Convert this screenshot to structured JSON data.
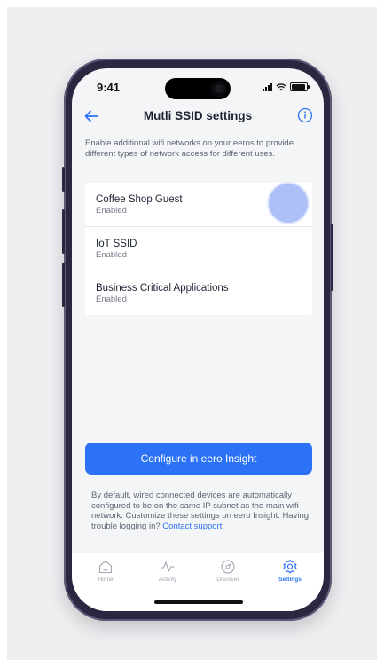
{
  "status_bar": {
    "time": "9:41"
  },
  "header": {
    "title": "Mutli SSID settings"
  },
  "intro_text": "Enable additional wifi networks on your eeros to provide different types of network access for different uses.",
  "networks": [
    {
      "name": "Coffee Shop Guest",
      "status": "Enabled"
    },
    {
      "name": "IoT SSID",
      "status": "Enabled"
    },
    {
      "name": "Business Critical Applications",
      "status": "Enabled"
    }
  ],
  "configure_button": {
    "label": "Configure in eero Insight"
  },
  "footnote": {
    "text": "By default, wired connected devices are automatically configured to be on the same IP subnet as the main wifi network. Customize these settings on eero Insight. Having trouble logging in?",
    "link": "Contact support"
  },
  "tabs": [
    {
      "label": "Home",
      "icon": "home-icon",
      "active": false
    },
    {
      "label": "Activity",
      "icon": "activity-icon",
      "active": false
    },
    {
      "label": "Discover",
      "icon": "compass-icon",
      "active": false
    },
    {
      "label": "Settings",
      "icon": "gear-icon",
      "active": true
    }
  ],
  "colors": {
    "accent": "#2b72f6",
    "background": "#f4f5f7",
    "text": "#1d2333"
  }
}
